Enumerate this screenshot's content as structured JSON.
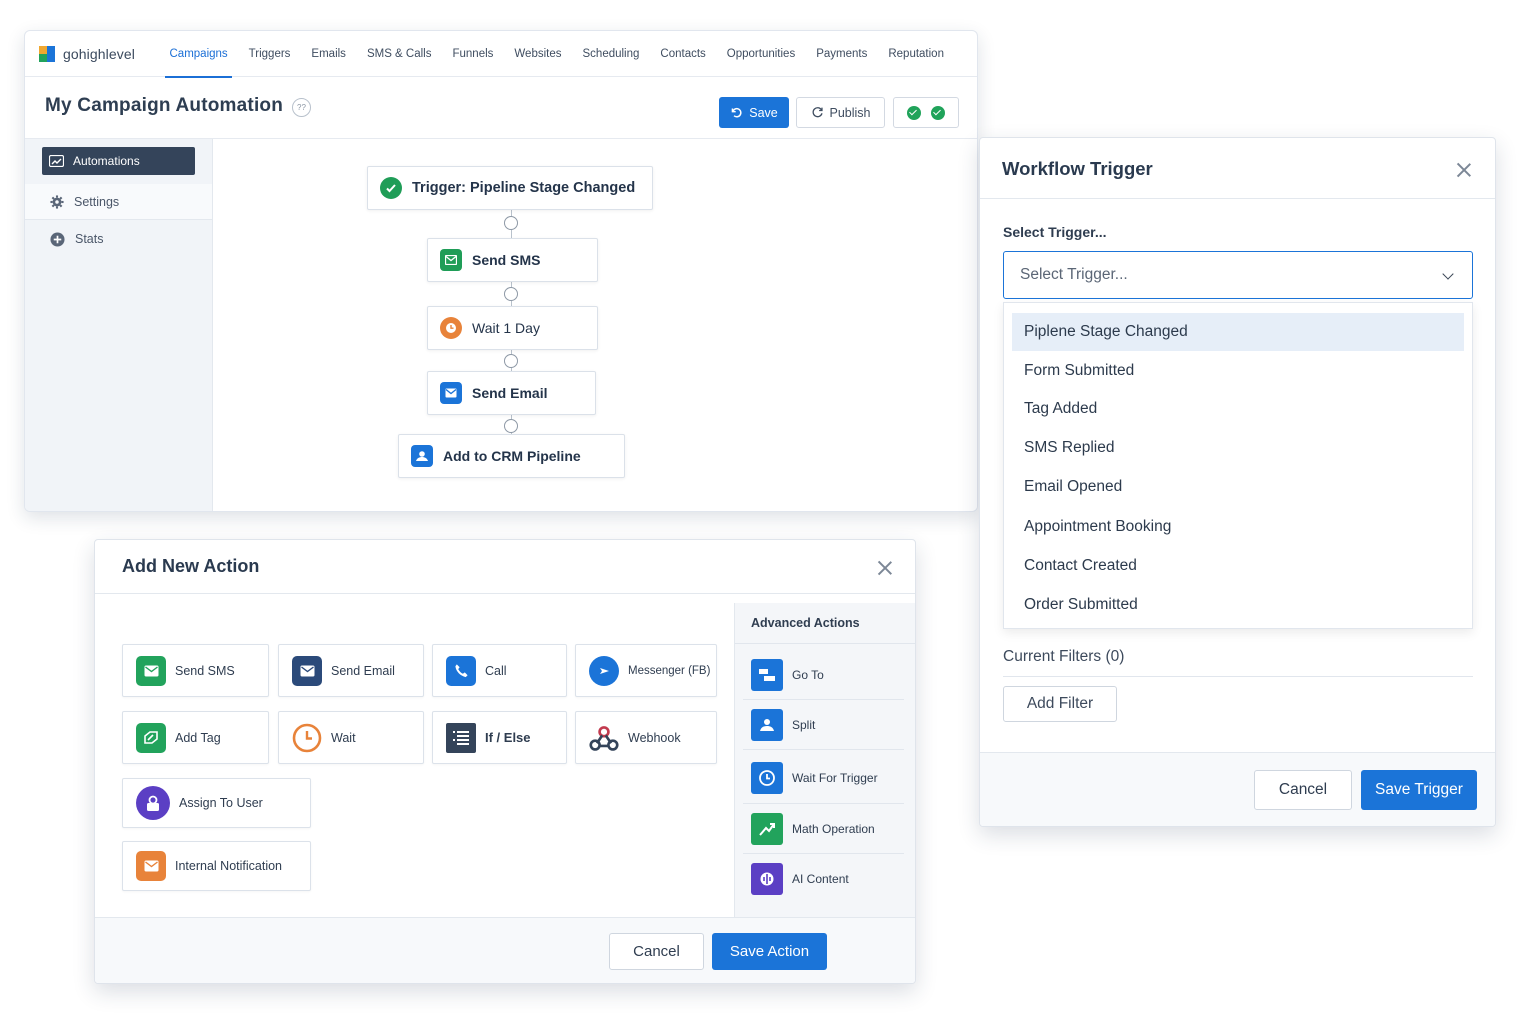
{
  "nav": {
    "logo": "gohighlevel",
    "items": [
      "Campaigns",
      "Triggers",
      "Emails",
      "SMS & Calls",
      "Funnels",
      "Websites",
      "Scheduling",
      "Contacts",
      "Opportunities",
      "Payments",
      "Reputation"
    ],
    "active": "Campaigns"
  },
  "header": {
    "title": "My Campaign Automation",
    "help_badge": "??",
    "save_label": "Save",
    "publish_label": "Publish"
  },
  "sidebar": {
    "items": [
      {
        "label": "Automations",
        "icon": "automation-icon",
        "active": true
      },
      {
        "label": "Settings",
        "icon": "gear-icon"
      },
      {
        "label": "Stats",
        "icon": "plus-circle-icon"
      }
    ]
  },
  "workflow": {
    "nodes": [
      {
        "label": "Trigger: Pipeline Stage Changed",
        "icon": "check-circle-icon",
        "color": "#1f9d57"
      },
      {
        "label": "Send SMS",
        "icon": "sms-icon",
        "color": "#1f9d57"
      },
      {
        "label": "Wait 1 Day",
        "icon": "clock-icon",
        "color": "#e8833a"
      },
      {
        "label": "Send Email",
        "icon": "email-icon",
        "color": "#1b74d8"
      },
      {
        "label": "Add to CRM Pipeline",
        "icon": "pipeline-icon",
        "color": "#1b74d8"
      }
    ]
  },
  "action_modal": {
    "title": "Add New Action",
    "actions": [
      {
        "label": "Send SMS",
        "icon": "sms-icon",
        "color": "#22a35c"
      },
      {
        "label": "Send Email",
        "icon": "email-icon",
        "color": "#2b4a7a"
      },
      {
        "label": "Call",
        "icon": "phone-icon",
        "color": "#1b74d8"
      },
      {
        "label": "Messenger (FB)",
        "icon": "messenger-icon",
        "color": "#1b74d8"
      },
      {
        "label": "Add Tag",
        "icon": "tag-icon",
        "color": "#22a35c"
      },
      {
        "label": "Wait",
        "icon": "clock-icon",
        "color": "#e8833a"
      },
      {
        "label": "If / Else",
        "icon": "list-icon",
        "color": "#34445a"
      },
      {
        "label": "Webhook",
        "icon": "webhook-icon",
        "color": "#34445a"
      },
      {
        "label": "Assign To User",
        "icon": "user-lock-icon",
        "color": "#5b3fc4"
      },
      {
        "label": "Internal Notification",
        "icon": "notification-icon",
        "color": "#e8833a"
      }
    ],
    "advanced_title": "Advanced Actions",
    "advanced": [
      {
        "label": "Go To",
        "icon": "goto-icon",
        "color": "#1b74d8"
      },
      {
        "label": "Split",
        "icon": "split-icon",
        "color": "#1b74d8"
      },
      {
        "label": "Wait For Trigger",
        "icon": "clock-icon",
        "color": "#1b74d8"
      },
      {
        "label": "Math Operation",
        "icon": "math-icon",
        "color": "#22a35c"
      },
      {
        "label": "AI Content",
        "icon": "ai-icon",
        "color": "#5b3fc4"
      }
    ],
    "cancel_label": "Cancel",
    "save_label": "Save Action"
  },
  "trigger_panel": {
    "title": "Workflow Trigger",
    "select_label": "Select Trigger...",
    "select_placeholder": "Select Trigger...",
    "options": [
      "Piplene Stage Changed",
      "Form Submitted",
      "Tag Added",
      "SMS Replied",
      "Email Opened",
      "Appointment Booking",
      "Contact Created",
      "Order Submitted"
    ],
    "highlighted_option": "Piplene Stage Changed",
    "filters_label": "Current Filters (0)",
    "add_filter_label": "Add Filter",
    "cancel_label": "Cancel",
    "save_label": "Save Trigger"
  }
}
